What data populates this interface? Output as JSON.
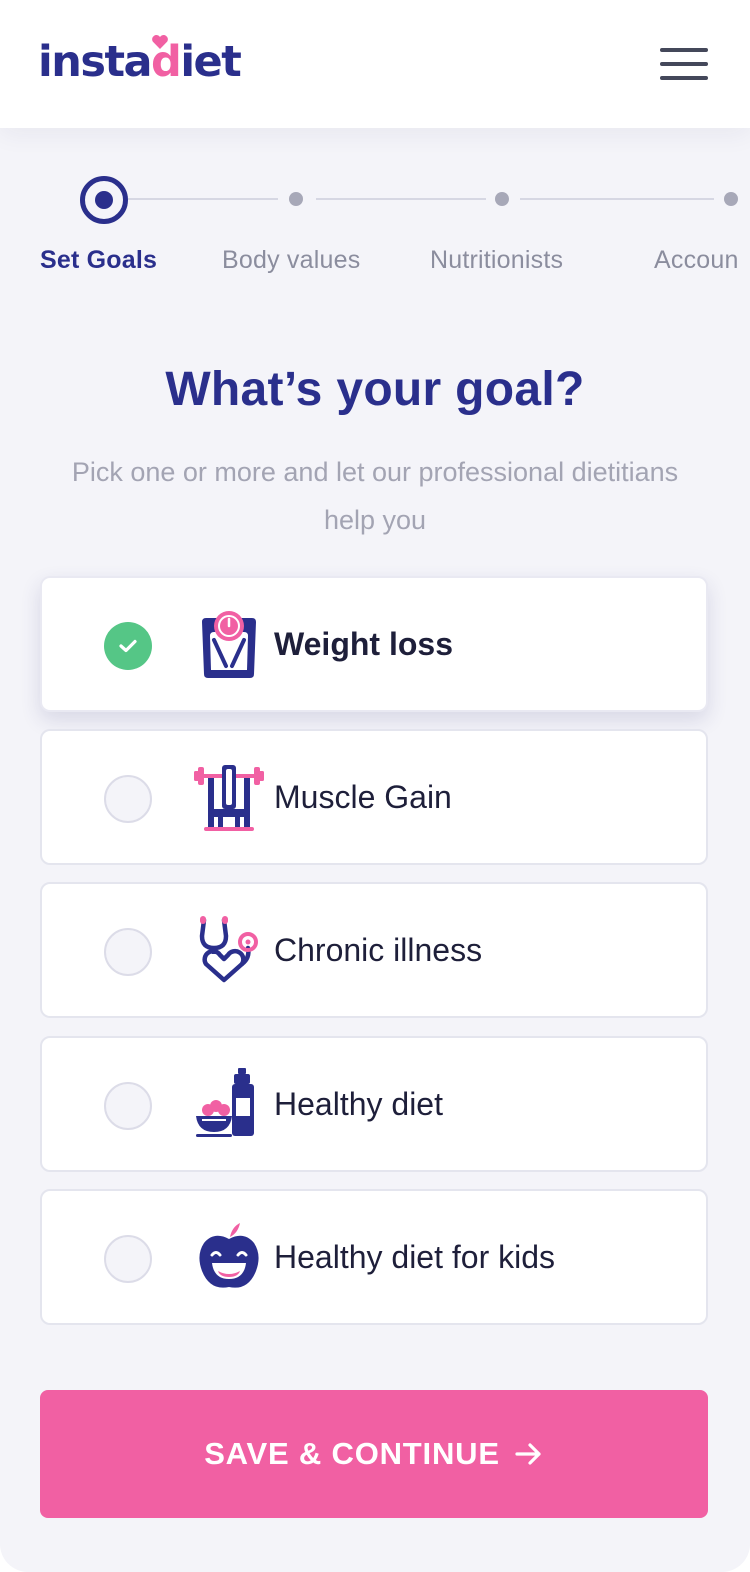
{
  "header": {
    "logo_text_left": "insta",
    "logo_text_right": "iet",
    "logo_heart_letter": "d",
    "menu_icon": "hamburger-menu-icon"
  },
  "stepper": {
    "steps": [
      {
        "label": "Set Goals",
        "state": "current"
      },
      {
        "label": "Body values",
        "state": "upcoming"
      },
      {
        "label": "Nutritionists",
        "state": "upcoming"
      },
      {
        "label": "Accoun",
        "state": "upcoming"
      }
    ]
  },
  "main": {
    "title": "What’s your goal?",
    "subtitle": "Pick one or more and let our professional dietitians help you"
  },
  "goals": [
    {
      "label": "Weight loss",
      "selected": true,
      "icon": "scale-icon"
    },
    {
      "label": "Muscle Gain",
      "selected": false,
      "icon": "bench-press-icon"
    },
    {
      "label": "Chronic illness",
      "selected": false,
      "icon": "stethoscope-icon"
    },
    {
      "label": "Healthy diet",
      "selected": false,
      "icon": "salad-bottle-icon"
    },
    {
      "label": "Healthy diet for kids",
      "selected": false,
      "icon": "apple-face-icon"
    }
  ],
  "cta": {
    "label": "SAVE & CONTINUE",
    "icon": "arrow-right-icon"
  },
  "colors": {
    "brand_navy": "#2a2f8c",
    "accent_pink": "#f160a3",
    "check_green": "#55c686",
    "background": "#f4f4f9"
  }
}
